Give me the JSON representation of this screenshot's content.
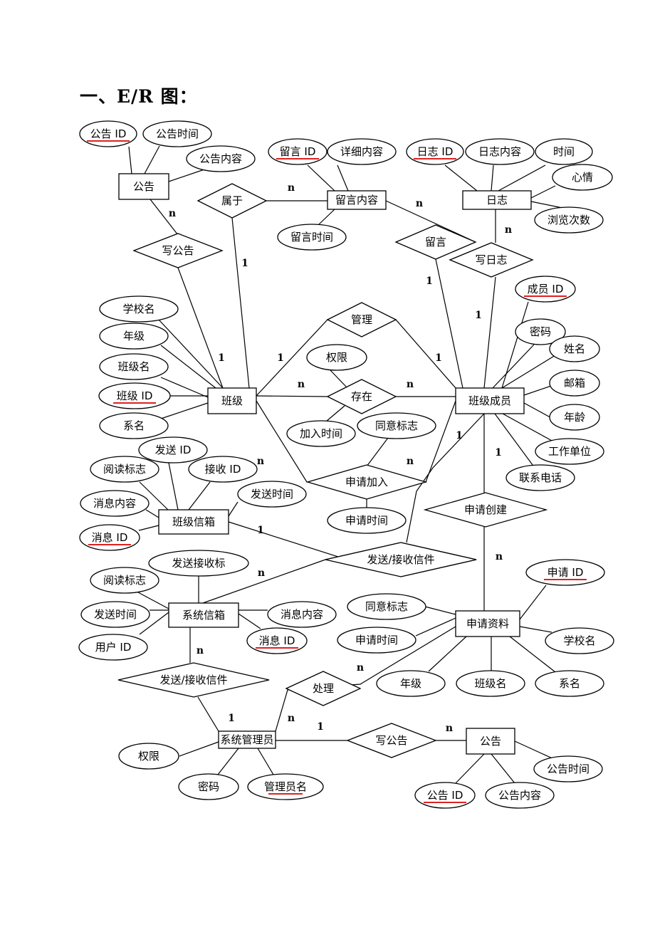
{
  "title": "一、E/R 图：",
  "colors": {
    "line": "#000000",
    "key_underline": "#e02020",
    "background": "#ffffff"
  },
  "entities": [
    {
      "id": "e_gonggao1",
      "label": "公告"
    },
    {
      "id": "e_liuyan",
      "label": "留言内容"
    },
    {
      "id": "e_rizhi",
      "label": "日志"
    },
    {
      "id": "e_banji",
      "label": "班级"
    },
    {
      "id": "e_chengyuan",
      "label": "班级成员"
    },
    {
      "id": "e_banjixinxiang",
      "label": "班级信箱"
    },
    {
      "id": "e_xitongxinxiang",
      "label": "系统信箱"
    },
    {
      "id": "e_shenqing",
      "label": "申请资料"
    },
    {
      "id": "e_guanliyuan",
      "label": "系统管理员"
    },
    {
      "id": "e_gonggao2",
      "label": "公告"
    }
  ],
  "relationships": [
    {
      "id": "r_shuyu",
      "label": "属于"
    },
    {
      "id": "r_xiegonggao1",
      "label": "写公告"
    },
    {
      "id": "r_liuyan",
      "label": "留言"
    },
    {
      "id": "r_xierizhi",
      "label": "写日志"
    },
    {
      "id": "r_guanli",
      "label": "管理"
    },
    {
      "id": "r_cunzai",
      "label": "存在"
    },
    {
      "id": "r_shenqingjiaru",
      "label": "申请加入"
    },
    {
      "id": "r_shenqingchuangjian",
      "label": "申请创建"
    },
    {
      "id": "r_fasong1",
      "label": "发送/接收信件"
    },
    {
      "id": "r_fasong2",
      "label": "发送/接收信件"
    },
    {
      "id": "r_chuli",
      "label": "处理"
    },
    {
      "id": "r_xiegonggao2",
      "label": "写公告"
    }
  ],
  "attributes": [
    {
      "id": "a1",
      "label": "公告 ID",
      "key": true,
      "of": "公告"
    },
    {
      "id": "a2",
      "label": "公告时间",
      "key": false,
      "of": "公告"
    },
    {
      "id": "a3",
      "label": "公告内容",
      "key": false,
      "of": "公告"
    },
    {
      "id": "a4",
      "label": "留言 ID",
      "key": true,
      "of": "留言内容"
    },
    {
      "id": "a5",
      "label": "详细内容",
      "key": false,
      "of": "留言内容"
    },
    {
      "id": "a6",
      "label": "留言时间",
      "key": false,
      "of": "留言内容"
    },
    {
      "id": "a7",
      "label": "日志 ID",
      "key": true,
      "of": "日志"
    },
    {
      "id": "a8",
      "label": "日志内容",
      "key": false,
      "of": "日志"
    },
    {
      "id": "a9",
      "label": "时间",
      "key": false,
      "of": "日志"
    },
    {
      "id": "a10",
      "label": "心情",
      "key": false,
      "of": "日志"
    },
    {
      "id": "a11",
      "label": "浏览次数",
      "key": false,
      "of": "日志"
    },
    {
      "id": "a12",
      "label": "学校名",
      "key": false,
      "of": "班级"
    },
    {
      "id": "a13",
      "label": "年级",
      "key": false,
      "of": "班级"
    },
    {
      "id": "a14",
      "label": "班级名",
      "key": false,
      "of": "班级"
    },
    {
      "id": "a15",
      "label": "班级 ID",
      "key": true,
      "of": "班级"
    },
    {
      "id": "a16",
      "label": "系名",
      "key": false,
      "of": "班级"
    },
    {
      "id": "a17",
      "label": "成员 ID",
      "key": true,
      "of": "班级成员"
    },
    {
      "id": "a18",
      "label": "密码",
      "key": false,
      "of": "班级成员"
    },
    {
      "id": "a19",
      "label": "姓名",
      "key": false,
      "of": "班级成员"
    },
    {
      "id": "a20",
      "label": "邮箱",
      "key": false,
      "of": "班级成员"
    },
    {
      "id": "a21",
      "label": "年龄",
      "key": false,
      "of": "班级成员"
    },
    {
      "id": "a22",
      "label": "工作单位",
      "key": false,
      "of": "班级成员"
    },
    {
      "id": "a23",
      "label": "联系电话",
      "key": false,
      "of": "班级成员"
    },
    {
      "id": "a24",
      "label": "权限",
      "key": false,
      "of": "存在"
    },
    {
      "id": "a25",
      "label": "加入时间",
      "key": false,
      "of": "存在"
    },
    {
      "id": "a26",
      "label": "同意标志",
      "key": false,
      "of": "申请加入"
    },
    {
      "id": "a27",
      "label": "申请时间",
      "key": false,
      "of": "申请加入"
    },
    {
      "id": "a28",
      "label": "发送 ID",
      "key": false,
      "of": "班级信箱"
    },
    {
      "id": "a29",
      "label": "阅读标志",
      "key": false,
      "of": "班级信箱"
    },
    {
      "id": "a30",
      "label": "接收 ID",
      "key": false,
      "of": "班级信箱"
    },
    {
      "id": "a31",
      "label": "消息内容",
      "key": false,
      "of": "班级信箱"
    },
    {
      "id": "a32",
      "label": "发送时间",
      "key": false,
      "of": "班级信箱"
    },
    {
      "id": "a33",
      "label": "消息 ID",
      "key": true,
      "of": "班级信箱"
    },
    {
      "id": "a34",
      "label": "发送接收标",
      "key": false,
      "of": "系统信箱"
    },
    {
      "id": "a35",
      "label": "阅读标志",
      "key": false,
      "of": "系统信箱"
    },
    {
      "id": "a36",
      "label": "发送时间",
      "key": false,
      "of": "系统信箱"
    },
    {
      "id": "a37",
      "label": "用户 ID",
      "key": false,
      "of": "系统信箱"
    },
    {
      "id": "a38",
      "label": "消息内容",
      "key": false,
      "of": "系统信箱"
    },
    {
      "id": "a39",
      "label": "消息 ID",
      "key": true,
      "of": "系统信箱"
    },
    {
      "id": "a40",
      "label": "申请 ID",
      "key": true,
      "of": "申请资料"
    },
    {
      "id": "a41",
      "label": "同意标志",
      "key": false,
      "of": "申请资料"
    },
    {
      "id": "a42",
      "label": "申请时间",
      "key": false,
      "of": "申请资料"
    },
    {
      "id": "a43",
      "label": "学校名",
      "key": false,
      "of": "申请资料"
    },
    {
      "id": "a44",
      "label": "年级",
      "key": false,
      "of": "申请资料"
    },
    {
      "id": "a45",
      "label": "班级名",
      "key": false,
      "of": "申请资料"
    },
    {
      "id": "a46",
      "label": "系名",
      "key": false,
      "of": "申请资料"
    },
    {
      "id": "a47",
      "label": "权限",
      "key": false,
      "of": "系统管理员"
    },
    {
      "id": "a48",
      "label": "密码",
      "key": false,
      "of": "系统管理员"
    },
    {
      "id": "a49",
      "label": "管理员名",
      "key": true,
      "of": "系统管理员"
    },
    {
      "id": "a50",
      "label": "公告时间",
      "key": false,
      "of": "公告"
    },
    {
      "id": "a51",
      "label": "公告 ID",
      "key": true,
      "of": "公告"
    },
    {
      "id": "a52",
      "label": "公告内容",
      "key": false,
      "of": "公告"
    }
  ],
  "cardinalities": [
    {
      "id": "c1",
      "label": "n"
    },
    {
      "id": "c2",
      "label": "1"
    },
    {
      "id": "c3",
      "label": "n"
    },
    {
      "id": "c4",
      "label": "1"
    },
    {
      "id": "c5",
      "label": "n"
    },
    {
      "id": "c6",
      "label": "1"
    },
    {
      "id": "c7",
      "label": "n"
    },
    {
      "id": "c8",
      "label": "1"
    },
    {
      "id": "c9",
      "label": "1"
    },
    {
      "id": "c10",
      "label": "1"
    },
    {
      "id": "c11",
      "label": "1"
    },
    {
      "id": "c12",
      "label": "n"
    },
    {
      "id": "c13",
      "label": "n"
    },
    {
      "id": "c14",
      "label": "n"
    },
    {
      "id": "c15",
      "label": "1"
    },
    {
      "id": "c16",
      "label": "1"
    },
    {
      "id": "c17",
      "label": "n"
    },
    {
      "id": "c18",
      "label": "n"
    },
    {
      "id": "c19",
      "label": "n"
    },
    {
      "id": "c20",
      "label": "n"
    },
    {
      "id": "c21",
      "label": "n"
    },
    {
      "id": "c22",
      "label": "n"
    },
    {
      "id": "c23",
      "label": "1"
    },
    {
      "id": "c24",
      "label": "n"
    },
    {
      "id": "c25",
      "label": "1"
    },
    {
      "id": "c26",
      "label": "n"
    }
  ]
}
